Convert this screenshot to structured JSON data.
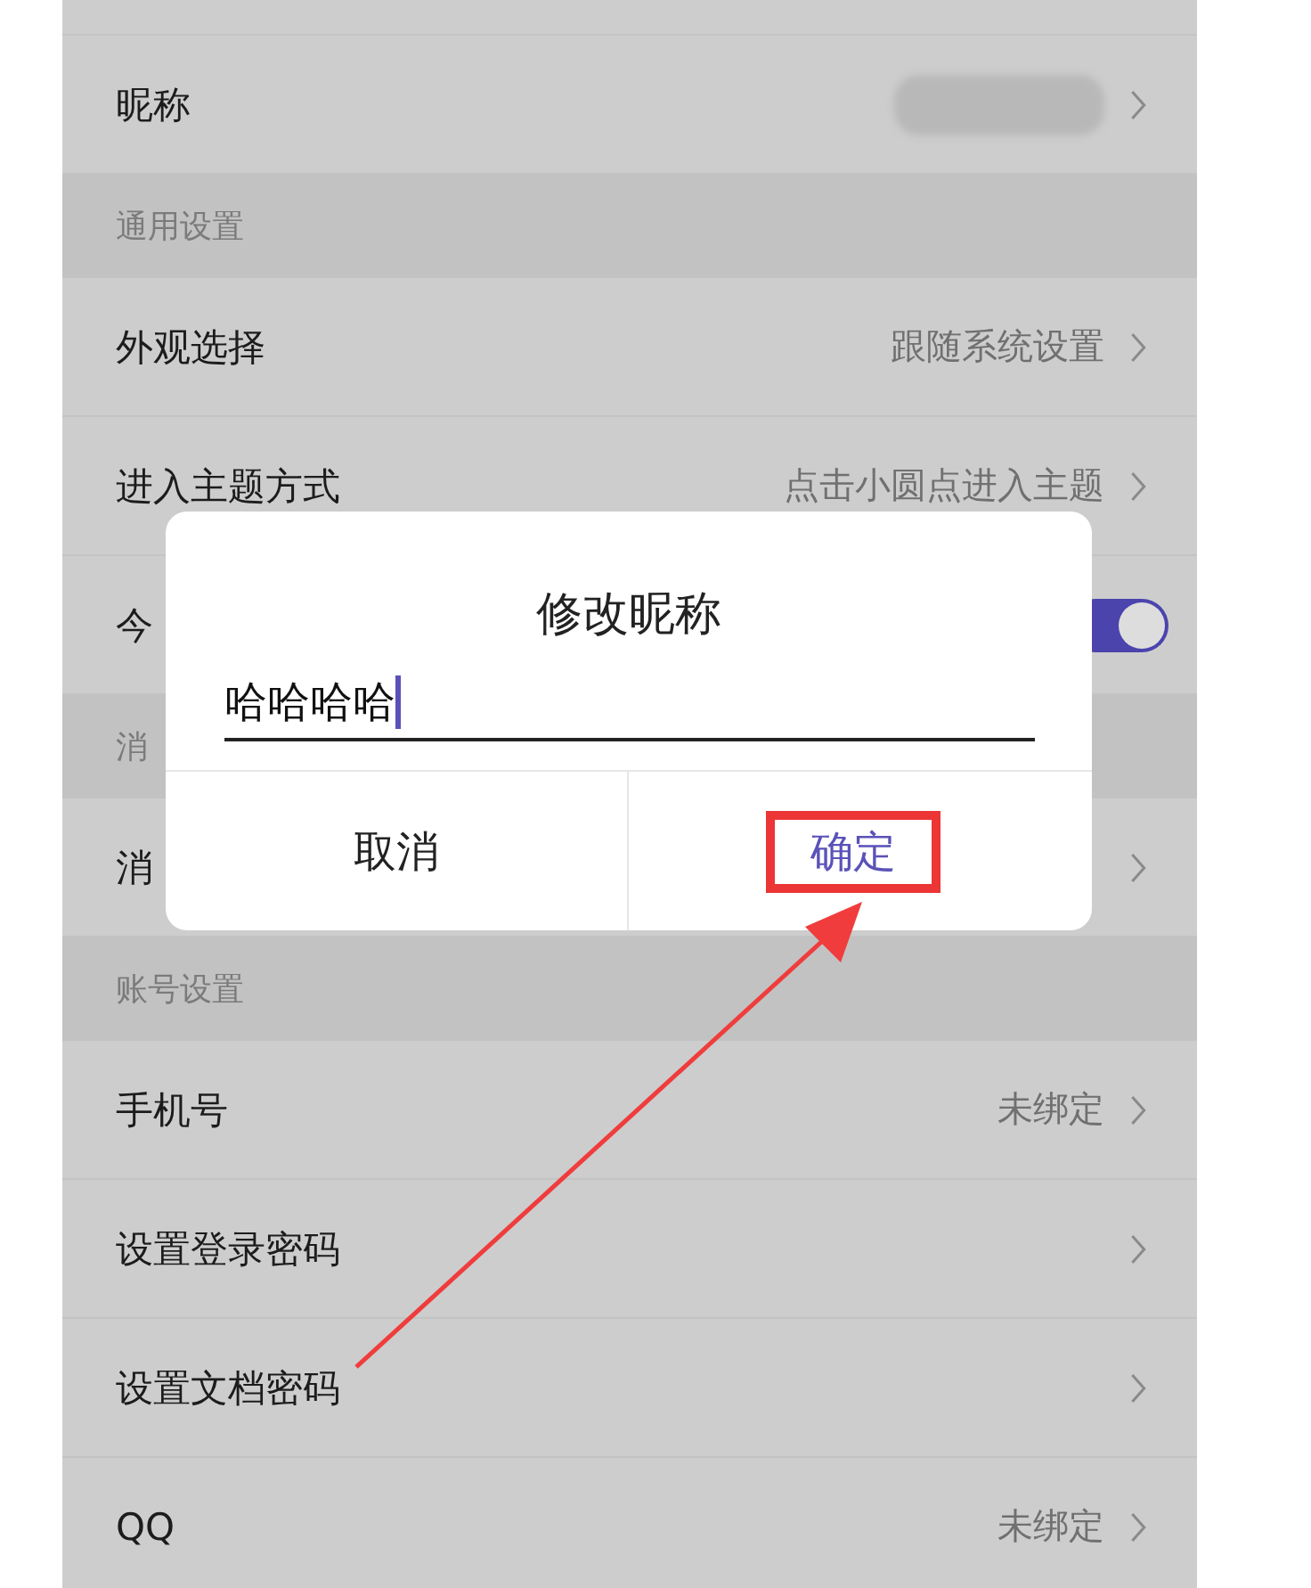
{
  "settings": [
    {
      "kind": "row",
      "label": "昵称",
      "value_blurred": true,
      "chevron": true
    },
    {
      "kind": "header",
      "label": "通用设置"
    },
    {
      "kind": "row",
      "label": "外观选择",
      "value": "跟随系统设置",
      "chevron": true
    },
    {
      "kind": "row",
      "label": "进入主题方式",
      "value": "点击小圆点进入主题",
      "chevron": true
    },
    {
      "kind": "toggle",
      "label": "今",
      "on": true
    },
    {
      "kind": "header",
      "label": "消"
    },
    {
      "kind": "row",
      "label": "消",
      "chevron": true
    },
    {
      "kind": "header",
      "label": "账号设置"
    },
    {
      "kind": "row",
      "label": "手机号",
      "value": "未绑定",
      "chevron": true
    },
    {
      "kind": "row",
      "label": "设置登录密码",
      "chevron": true
    },
    {
      "kind": "row",
      "label": "设置文档密码",
      "chevron": true
    },
    {
      "kind": "row",
      "label": "QQ",
      "value": "未绑定",
      "chevron": true
    }
  ],
  "dialog": {
    "title": "修改昵称",
    "input_value": "哈哈哈哈",
    "buttons": [
      {
        "label": "取消",
        "kind": "cancel"
      },
      {
        "label": "确定",
        "kind": "confirm"
      }
    ]
  }
}
